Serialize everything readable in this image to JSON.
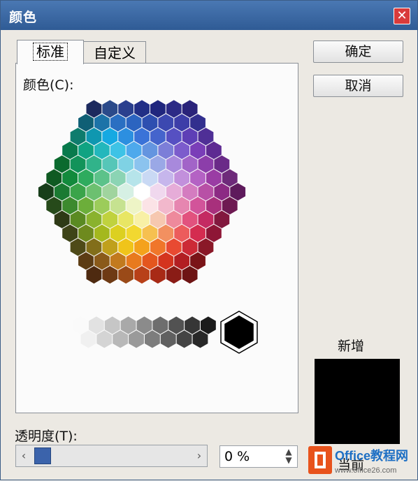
{
  "window": {
    "title": "颜色",
    "close": "✕"
  },
  "tabs": [
    {
      "label": "标准"
    },
    {
      "label": "自定义"
    }
  ],
  "colors_label": "颜色(C):",
  "buttons": {
    "ok": "确定",
    "cancel": "取消"
  },
  "new_label": "新增",
  "current_label": "当前",
  "transparency": {
    "label": "透明度(T):",
    "value_text": "0 %",
    "value": 0
  },
  "slider": {
    "left_arrow": "‹",
    "right_arrow": "›"
  },
  "spinner": {
    "up": "▲",
    "down": "▼"
  },
  "watermark": {
    "brand": "Office教程网",
    "url": "www.office26.com"
  },
  "colors": {
    "new": "#000000",
    "current": "#000000",
    "accent": "#3b63ab",
    "titlebar": "#2f5b95"
  },
  "hexagon_palette": [
    [
      "#1c2a5e",
      "#2b4a8a",
      "#2a3f8e",
      "#222f86",
      "#20267e",
      "#2c2a86",
      "#2a237a"
    ],
    [
      "#0f5f75",
      "#1c73a8",
      "#2a6fc2",
      "#2c64c0",
      "#2e4fb0",
      "#3c48b0",
      "#3d3ea8",
      "#322f8e"
    ],
    [
      "#0e7c6d",
      "#0f97b0",
      "#16a9e2",
      "#2c8fe0",
      "#3a73d8",
      "#4564cc",
      "#5650c2",
      "#5e3fb6",
      "#4f2f96"
    ],
    [
      "#087a4c",
      "#10a382",
      "#23b7bc",
      "#3ec3e6",
      "#4ea9ec",
      "#6495e0",
      "#7c7ed8",
      "#7c5ccc",
      "#7a3eb8",
      "#5e2a92"
    ],
    [
      "#0b6a2e",
      "#12935a",
      "#31b38a",
      "#56c6b8",
      "#7fd2e4",
      "#8bc3ee",
      "#9aa8e6",
      "#a889dc",
      "#a264c8",
      "#8c3eaa",
      "#6a2a88"
    ],
    [
      "#0f5a22",
      "#128a3c",
      "#2eab5e",
      "#5cc28a",
      "#8bd4b4",
      "#b6e4ea",
      "#c9d9f4",
      "#c6b6ec",
      "#c290dc",
      "#b462c4",
      "#9a3ca4",
      "#6e2a7a"
    ],
    [
      "#173e1a",
      "#1a7a32",
      "#3aa44a",
      "#6cc070",
      "#a0d49e",
      "#d6f0e4",
      "#ffffff",
      "#f0d8ee",
      "#e6acd8",
      "#d47cc0",
      "#b850a6",
      "#8c2a84",
      "#5e1a5c"
    ],
    [
      "#264a1a",
      "#3c8a2e",
      "#6cae3a",
      "#9ccc5a",
      "#c6e290",
      "#eef4c6",
      "#fbe3e6",
      "#f2b8cc",
      "#e686b0",
      "#d2549a",
      "#a8307c",
      "#6e1a52"
    ],
    [
      "#2e3a16",
      "#5a8a22",
      "#8ab22e",
      "#c0d23e",
      "#e8e664",
      "#f8f0a6",
      "#f6c8b0",
      "#ee8a9c",
      "#e2527e",
      "#c42a62",
      "#82183e"
    ],
    [
      "#3e4418",
      "#6e8a1e",
      "#a4b81e",
      "#dcd020",
      "#f2d830",
      "#f6c050",
      "#f29060",
      "#ec5c5c",
      "#d42c50",
      "#8e1636"
    ],
    [
      "#4e4a18",
      "#826e1a",
      "#c0a01c",
      "#f0c41a",
      "#f4a21c",
      "#f0762a",
      "#e84a32",
      "#cc2a36",
      "#8a1828"
    ],
    [
      "#5c3c14",
      "#8a5a1a",
      "#c27a1e",
      "#e87a1e",
      "#e4561e",
      "#d4341e",
      "#b21e22",
      "#7a1418"
    ],
    [
      "#4e2a10",
      "#6e3a14",
      "#9a4a18",
      "#b84018",
      "#a82a16",
      "#8a1c16",
      "#6e1414"
    ]
  ],
  "gray_palette": {
    "top": [
      "#fafafa",
      "#e2e2e2",
      "#c6c6c6",
      "#a9a9a9",
      "#8b8b8b",
      "#6e6e6e",
      "#525252",
      "#363636",
      "#1b1b1b"
    ],
    "bottom": [
      "#f0f0f0",
      "#d4d4d4",
      "#b8b8b8",
      "#9a9a9a",
      "#7d7d7d",
      "#606060",
      "#444444",
      "#282828"
    ]
  }
}
